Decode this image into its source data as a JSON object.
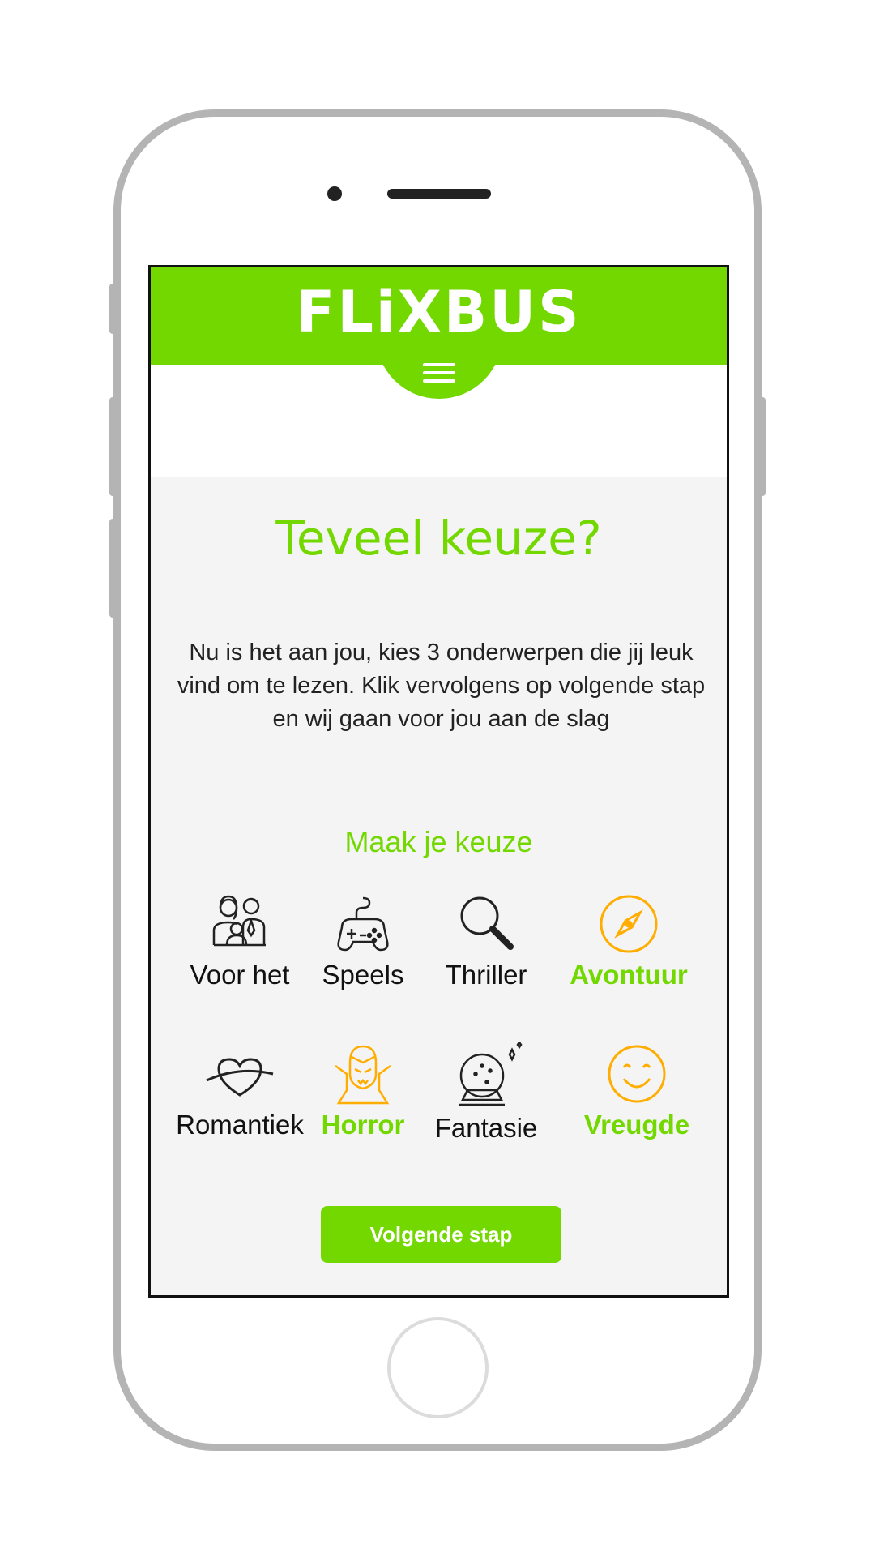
{
  "header": {
    "logo_text": "FLiXBUS",
    "menu_icon": "hamburger-menu-icon"
  },
  "main": {
    "title": "Teveel keuze?",
    "intro": "Nu is het aan jou, kies 3 onderwerpen die jij leuk vind om te lezen. Klik vervolgens op volgende stap en wij gaan voor jou aan de slag",
    "subtitle": "Maak je keuze"
  },
  "categories": [
    {
      "label": "Voor het",
      "icon": "family-icon",
      "selected": false
    },
    {
      "label": "Speels",
      "icon": "game-controller-icon",
      "selected": false
    },
    {
      "label": "Thriller",
      "icon": "magnifier-icon",
      "selected": false
    },
    {
      "label": "Avontuur",
      "icon": "compass-icon",
      "selected": true
    },
    {
      "label": "Romantiek",
      "icon": "heart-icon",
      "selected": false
    },
    {
      "label": "Horror",
      "icon": "vampire-icon",
      "selected": true
    },
    {
      "label": "Fantasie",
      "icon": "crystal-ball-icon",
      "selected": false
    },
    {
      "label": "Vreugde",
      "icon": "smiley-icon",
      "selected": true
    }
  ],
  "next_button": {
    "label": "Volgende stap"
  },
  "colors": {
    "brand_green": "#73d700",
    "selected_icon_orange": "#ffad00"
  }
}
